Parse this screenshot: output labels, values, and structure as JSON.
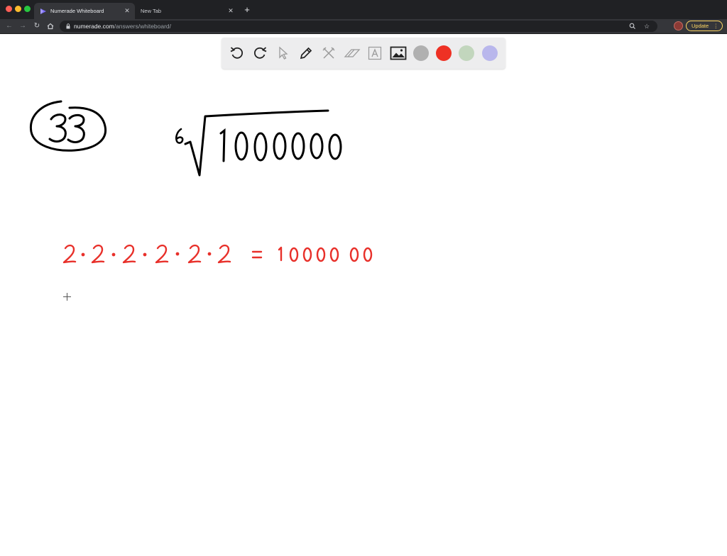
{
  "browser": {
    "tabs": [
      {
        "label": "Numerade Whiteboard",
        "active": true
      },
      {
        "label": "New Tab",
        "active": false
      }
    ],
    "address": {
      "host": "numerade.com",
      "path": "/answers/whiteboard/"
    },
    "update_label": "Update"
  },
  "toolbar": {
    "tools": [
      "undo-icon",
      "redo-icon",
      "select-pointer-icon",
      "pen-icon",
      "tools-icon",
      "eraser-icon",
      "text-box-icon",
      "image-icon"
    ],
    "colors": [
      "#b0b0b0",
      "#ee3124",
      "#c2d6bd",
      "#b9b7ec"
    ]
  },
  "whiteboard": {
    "problem_number": "33",
    "root_index": "6",
    "radicand": "1000000",
    "equation": "2·2·2·2·2·2 = 1000000",
    "ink_colors": {
      "black": "#000000",
      "red": "#e8302a"
    }
  }
}
